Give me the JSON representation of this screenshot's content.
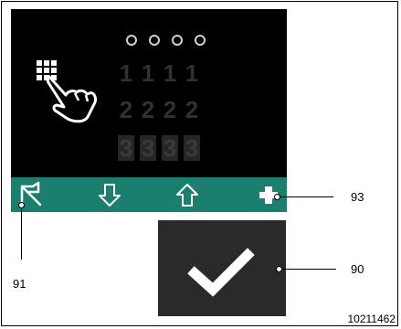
{
  "pin_digits": {
    "row1": [
      "1",
      "1",
      "1",
      "1"
    ],
    "row2": [
      "2",
      "2",
      "2",
      "2"
    ],
    "row3": [
      "3",
      "3",
      "3",
      "3"
    ]
  },
  "icons": {
    "keypad": "keypad-touch-icon",
    "back": "back-arrow-icon",
    "down": "down-arrow-icon",
    "up": "up-arrow-icon",
    "plus": "plus-icon",
    "confirm": "checkmark-icon"
  },
  "colors": {
    "screen_bg": "#000000",
    "bar_bg": "#1a7f6e",
    "confirm_bg": "#2a2a2a"
  },
  "callouts": {
    "back": "91",
    "plus": "93",
    "confirm": "90"
  },
  "document_number": "10211462"
}
